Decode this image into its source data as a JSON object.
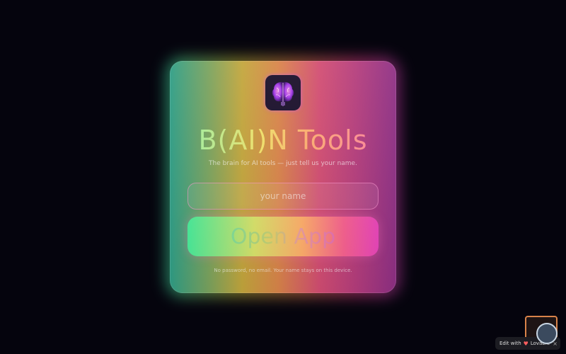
{
  "app": {
    "title": "B(AI)N Tools",
    "subtitle": "The brain for AI tools — just tell us your name.",
    "logo_icon": "brain-icon"
  },
  "form": {
    "name_placeholder": "your name",
    "name_value": "",
    "submit_label": "Open App",
    "footnote": "No password, no email. Your name stays on this device."
  },
  "badge": {
    "text": "Edit with",
    "brand": "Lovable"
  },
  "colors": {
    "background": "#05040d",
    "accent_green": "#48ec9a",
    "accent_pink": "#e944bb"
  }
}
